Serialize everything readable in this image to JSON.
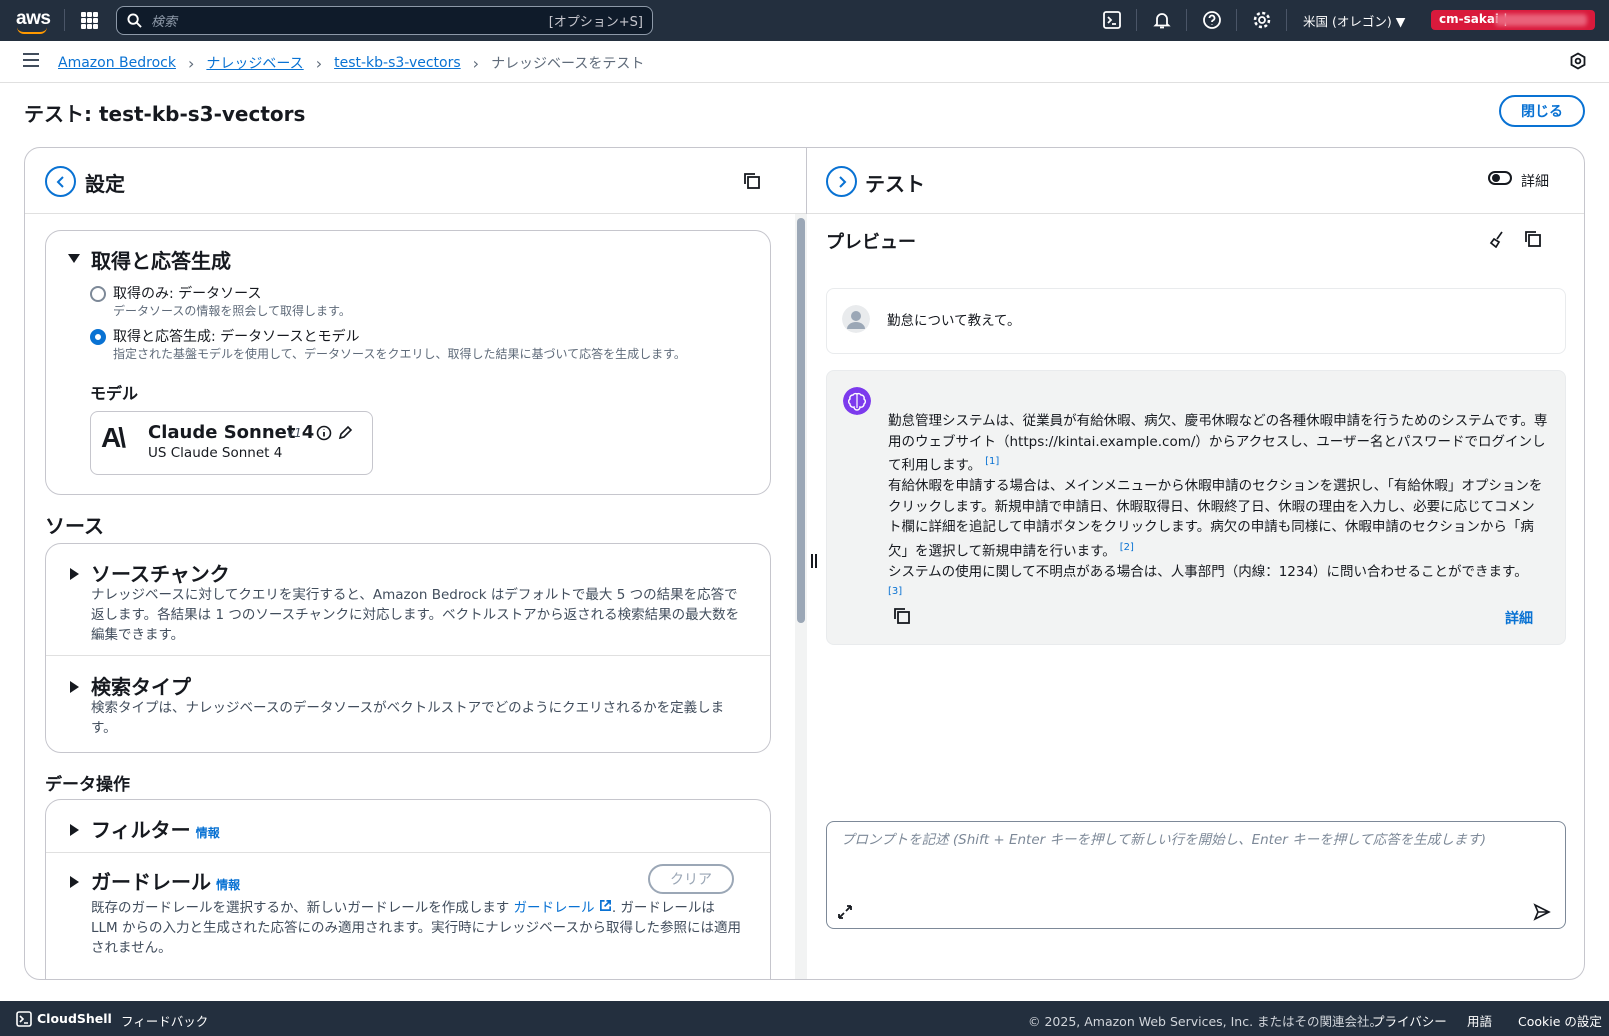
{
  "topnav": {
    "logo": "aws",
    "search_placeholder": "検索",
    "search_shortcut": "[オプション+S]",
    "region": "米国 (オレゴン) ▼",
    "account": "cm-sakai |"
  },
  "breadcrumb": {
    "items": [
      "Amazon Bedrock",
      "ナレッジベース",
      "test-kb-s3-vectors"
    ],
    "current": "ナレッジベースをテスト"
  },
  "page": {
    "title": "テスト: test-kb-s3-vectors",
    "close_label": "閉じる"
  },
  "settings": {
    "title": "設定",
    "retrieval": {
      "title": "取得と応答生成",
      "option1_label": "取得のみ: データソース",
      "option1_desc": "データソースの情報を照会して取得します。",
      "option2_label": "取得と応答生成: データソースとモデル",
      "option2_desc": "指定された基盤モデルを使用して、データソースをクエリし、取得した結果に基づいて応答を生成します。",
      "selected": "option2",
      "model_heading": "モデル",
      "model_name": "Claude Sonnet 4",
      "model_version": "v1",
      "model_sub": "US Claude Sonnet 4",
      "model_logo": "A\\"
    },
    "source_heading": "ソース",
    "source_chunks": {
      "title": "ソースチャンク",
      "desc": "ナレッジベースに対してクエリを実行すると、Amazon Bedrock はデフォルトで最大 5 つの結果を応答で返します。各結果は 1 つのソースチャンクに対応します。ベクトルストアから返される検索結果の最大数を編集できます。"
    },
    "search_type": {
      "title": "検索タイプ",
      "desc": "検索タイプは、ナレッジベースのデータソースがベクトルストアでどのようにクエリされるかを定義します。"
    },
    "data_ops_heading": "データ操作",
    "filter": {
      "title": "フィルター",
      "info": "情報"
    },
    "guardrail": {
      "title": "ガードレール",
      "info": "情報",
      "clear": "クリア",
      "desc_pre": "既存のガードレールを選択するか、新しいガードレールを作成します",
      "link": "ガードレール",
      "desc_post": ". ガードレールは LLM からの入力と生成された応答にのみ適用されます。実行時にナレッジベースから取得した参照には適用されません。"
    }
  },
  "test": {
    "title": "テスト",
    "detail_toggle": "詳細",
    "preview": "プレビュー",
    "user_message": "勤怠について教えて。",
    "response": {
      "p1": "勤怠管理システムは、従業員が有給休暇、病欠、慶弔休暇などの各種休暇申請を行うためのシステムです。専用のウェブサイト（https://kintai.example.com/）からアクセスし、ユーザー名とパスワードでログインして利用します。",
      "c1": "[1]",
      "p2": "有給休暇を申請する場合は、メインメニューから休暇申請のセクションを選択し、「有給休暇」オプションをクリックします。新規申請で申請日、休暇取得日、休暇終了日、休暇の理由を入力し、必要に応じてコメント欄に詳細を追記して申請ボタンをクリックします。病欠の申請も同様に、休暇申請のセクションから「病欠」を選択して新規申請を行います。",
      "c2": "[2]",
      "p3": "システムの使用に関して不明点がある場合は、人事部門（内線：1234）に問い合わせることができます。",
      "c3": "[3]",
      "details_link": "詳細"
    },
    "prompt_placeholder": "プロンプトを記述 (Shift + Enter キーを押して新しい行を開始し、Enter キーを押して応答を生成します)"
  },
  "footer": {
    "cloudshell": "CloudShell",
    "feedback": "フィードバック",
    "copyright": "© 2025, Amazon Web Services, Inc. またはその関連会社。",
    "privacy": "プライバシー",
    "terms": "用語",
    "cookie": "Cookie の設定"
  },
  "colors": {
    "accent": "#0972d3",
    "nav": "#232f3e",
    "account": "#d91a3c"
  }
}
